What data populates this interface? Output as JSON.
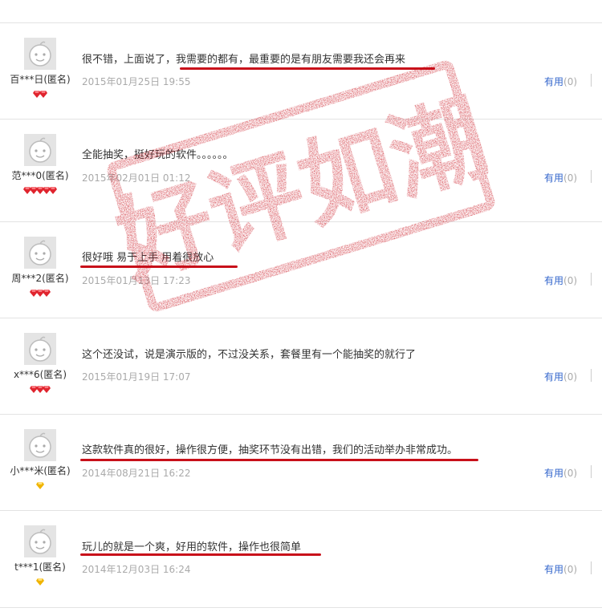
{
  "reviews": [
    {
      "user": "百***日(匿名)",
      "comment": "很不错，上面说了，我需要的都有，最重要的是有朋友需要我还会再来",
      "time": "2015年01月25日 19:55",
      "useful_label": "有用",
      "useful_count": "(0)",
      "badge": "red-diamond",
      "badge_count": 2
    },
    {
      "user": "范***0(匿名)",
      "comment": "全能抽奖，挺好玩的软件。。。。。。",
      "time": "2015年02月01日 01:12",
      "useful_label": "有用",
      "useful_count": "(0)",
      "badge": "red-diamond",
      "badge_count": 5
    },
    {
      "user": "周***2(匿名)",
      "comment": "很好哦 易于上手 用着很放心",
      "time": "2015年01月13日 17:23",
      "useful_label": "有用",
      "useful_count": "(0)",
      "badge": "red-diamond",
      "badge_count": 3
    },
    {
      "user": "x***6(匿名)",
      "comment": "这个还没试，说是演示版的，不过没关系，套餐里有一个能抽奖的就行了",
      "time": "2015年01月19日 17:07",
      "useful_label": "有用",
      "useful_count": "(0)",
      "badge": "red-diamond",
      "badge_count": 3
    },
    {
      "user": "小***米(匿名)",
      "comment": "这款软件真的很好，操作很方便，抽奖环节没有出错，我们的活动举办非常成功。",
      "time": "2014年08月21日 16:22",
      "useful_label": "有用",
      "useful_count": "(0)",
      "badge": "yellow-diamond",
      "badge_count": 1
    },
    {
      "user": "t***1(匿名)",
      "comment": "玩儿的就是一个爽，好用的软件，操作也很简单",
      "time": "2014年12月03日 16:24",
      "useful_label": "有用",
      "useful_count": "(0)",
      "badge": "yellow-diamond",
      "badge_count": 1
    }
  ],
  "stamp": {
    "text": "好评如潮",
    "color": "#c8101a"
  },
  "colors": {
    "underline": "#c8101a",
    "useful_link": "#3366cc",
    "timestamp": "#aaaaaa",
    "divider": "#e3e3e3"
  },
  "icons": {
    "avatar": "default-avatar-icon",
    "red_badge": "red-diamond-icon",
    "yellow_badge": "yellow-diamond-icon"
  }
}
